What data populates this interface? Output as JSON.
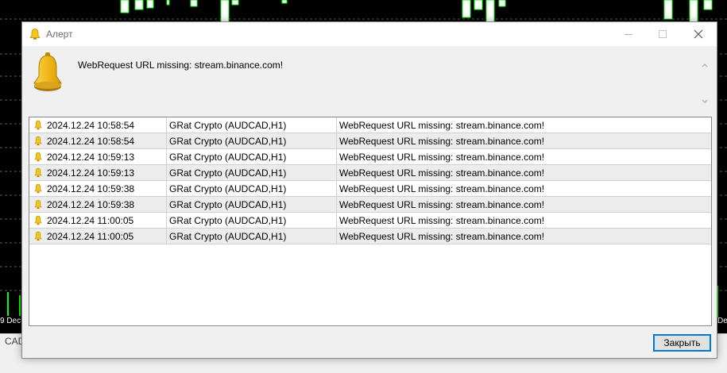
{
  "chart": {
    "bg_color": "#000000",
    "bull_color": "#00ff00",
    "date_label_left": "9 Dec",
    "date_label_right": "De",
    "symbol_tab": "CAD"
  },
  "dialog": {
    "title": "Алерт",
    "icon": "bell-icon",
    "message": "WebRequest URL missing: stream.binance.com!",
    "accent_color": "#0078d7",
    "close_label": "Закрыть"
  },
  "alerts": [
    {
      "time": "2024.12.24 10:58:54",
      "source": "GRat Crypto (AUDCAD,H1)",
      "message": "WebRequest URL missing: stream.binance.com!"
    },
    {
      "time": "2024.12.24 10:58:54",
      "source": "GRat Crypto (AUDCAD,H1)",
      "message": "WebRequest URL missing: stream.binance.com!"
    },
    {
      "time": "2024.12.24 10:59:13",
      "source": "GRat Crypto (AUDCAD,H1)",
      "message": "WebRequest URL missing: stream.binance.com!"
    },
    {
      "time": "2024.12.24 10:59:13",
      "source": "GRat Crypto (AUDCAD,H1)",
      "message": "WebRequest URL missing: stream.binance.com!"
    },
    {
      "time": "2024.12.24 10:59:38",
      "source": "GRat Crypto (AUDCAD,H1)",
      "message": "WebRequest URL missing: stream.binance.com!"
    },
    {
      "time": "2024.12.24 10:59:38",
      "source": "GRat Crypto (AUDCAD,H1)",
      "message": "WebRequest URL missing: stream.binance.com!"
    },
    {
      "time": "2024.12.24 11:00:05",
      "source": "GRat Crypto (AUDCAD,H1)",
      "message": "WebRequest URL missing: stream.binance.com!"
    },
    {
      "time": "2024.12.24 11:00:05",
      "source": "GRat Crypto (AUDCAD,H1)",
      "message": "WebRequest URL missing: stream.binance.com!"
    }
  ]
}
